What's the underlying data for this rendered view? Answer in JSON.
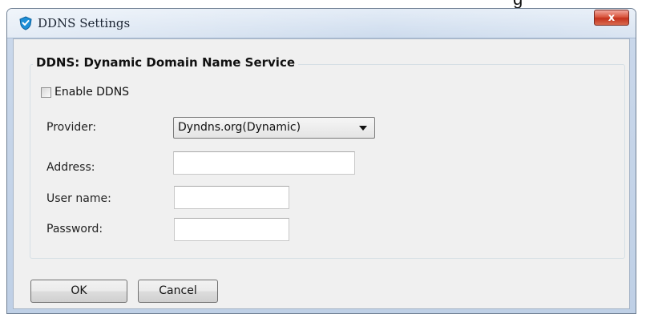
{
  "background_title_fragment": "g",
  "window": {
    "title": "DDNS Settings",
    "close_label": "x"
  },
  "ddns": {
    "group_title": "DDNS: Dynamic Domain Name Service",
    "enable_label": "Enable DDNS",
    "enabled": false,
    "provider": {
      "label": "Provider:",
      "selected": "Dyndns.org(Dynamic)"
    },
    "address": {
      "label": "Address:",
      "value": ""
    },
    "username": {
      "label": "User name:",
      "value": ""
    },
    "password": {
      "label": "Password:",
      "value": ""
    }
  },
  "buttons": {
    "ok_label": "OK",
    "cancel_label": "Cancel"
  },
  "icons": {
    "app_icon": "shield-check-icon",
    "close_icon": "close-icon",
    "dropdown_icon": "chevron-down-icon"
  },
  "colors": {
    "close_button": "#d9573f",
    "dialog_face": "#f0f0f0",
    "title_bar": "#c9d7ea"
  }
}
